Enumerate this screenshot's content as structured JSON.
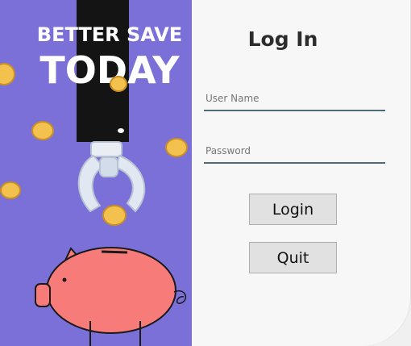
{
  "banner": {
    "line1": "BETTER SAVE",
    "line2": "TODAY"
  },
  "form": {
    "title": "Log In",
    "username": {
      "placeholder": "User Name",
      "value": ""
    },
    "password": {
      "placeholder": "Password",
      "value": ""
    },
    "login_label": "Login",
    "quit_label": "Quit"
  },
  "colors": {
    "art_background": "#7b6fd8",
    "form_background": "#f7f7f7",
    "field_underline": "#4e6b78",
    "button_face": "#e1e1e1",
    "coin": "#f2c14e",
    "piggy": "#f77b78"
  },
  "icons": [
    "coin-icon",
    "robot-hand-icon",
    "piggy-bank-icon"
  ]
}
